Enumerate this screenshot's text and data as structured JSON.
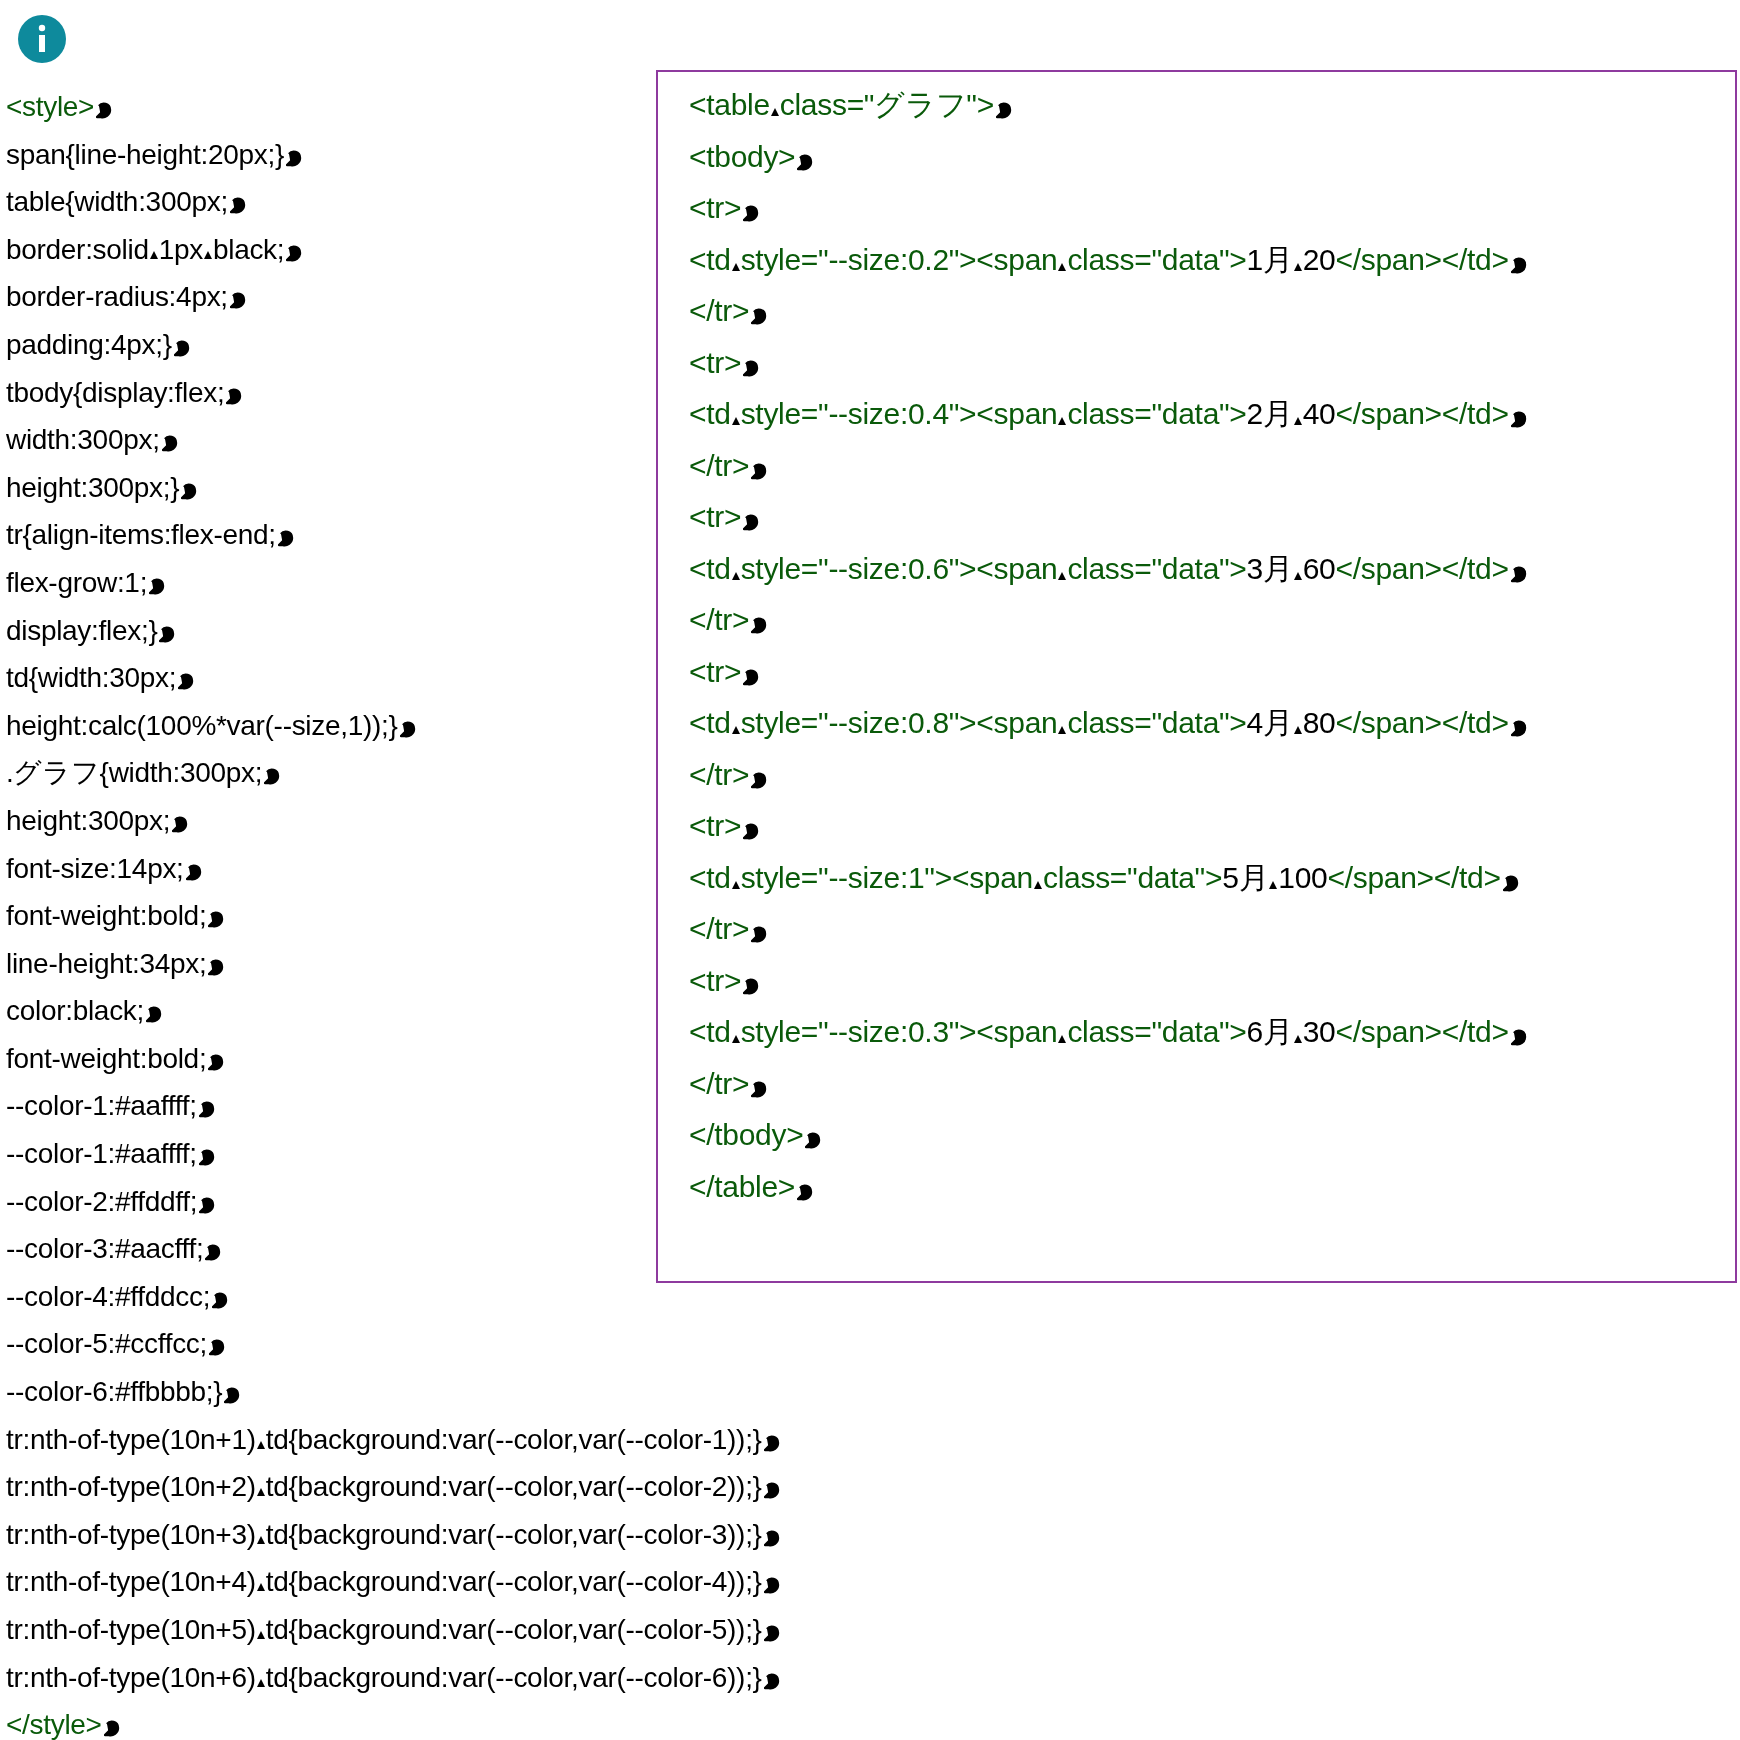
{
  "style_block": {
    "lines": [
      [
        {
          "kind": "tag",
          "text": "<style>"
        }
      ],
      [
        {
          "kind": "code",
          "text": "span{line-height:20px;}"
        }
      ],
      [
        {
          "kind": "code",
          "text": "table{width:300px;"
        }
      ],
      [
        {
          "kind": "code",
          "text": "border:solid 1px black;"
        }
      ],
      [
        {
          "kind": "code",
          "text": "border-radius:4px;"
        }
      ],
      [
        {
          "kind": "code",
          "text": "padding:4px;}"
        }
      ],
      [
        {
          "kind": "code",
          "text": "tbody{display:flex;"
        }
      ],
      [
        {
          "kind": "code",
          "text": "width:300px;"
        }
      ],
      [
        {
          "kind": "code",
          "text": "height:300px;}"
        }
      ],
      [
        {
          "kind": "code",
          "text": "tr{align-items:flex-end;"
        }
      ],
      [
        {
          "kind": "code",
          "text": "flex-grow:1;"
        }
      ],
      [
        {
          "kind": "code",
          "text": "display:flex;}"
        }
      ],
      [
        {
          "kind": "code",
          "text": "td{width:30px;"
        }
      ],
      [
        {
          "kind": "code",
          "text": "height:calc(100%*var(--size,1));}"
        }
      ],
      [
        {
          "kind": "code",
          "text": ".グラフ{width:300px;"
        }
      ],
      [
        {
          "kind": "code",
          "text": "height:300px;"
        }
      ],
      [
        {
          "kind": "code",
          "text": "font-size:14px;"
        }
      ],
      [
        {
          "kind": "code",
          "text": "font-weight:bold;"
        }
      ],
      [
        {
          "kind": "code",
          "text": "line-height:34px;"
        }
      ],
      [
        {
          "kind": "code",
          "text": "color:black;"
        }
      ],
      [
        {
          "kind": "code",
          "text": "font-weight:bold;"
        }
      ],
      [
        {
          "kind": "code",
          "text": "--color-1:#aaffff;"
        }
      ],
      [
        {
          "kind": "code",
          "text": "--color-1:#aaffff;"
        }
      ],
      [
        {
          "kind": "code",
          "text": "--color-2:#ffddff;"
        }
      ],
      [
        {
          "kind": "code",
          "text": "--color-3:#aacfff;"
        }
      ],
      [
        {
          "kind": "code",
          "text": "--color-4:#ffddcc;"
        }
      ],
      [
        {
          "kind": "code",
          "text": "--color-5:#ccffcc;"
        }
      ],
      [
        {
          "kind": "code",
          "text": "--color-6:#ffbbbb;}"
        }
      ],
      [
        {
          "kind": "code",
          "text": "tr:nth-of-type(10n+1) td{background:var(--color,var(--color-1));}"
        }
      ],
      [
        {
          "kind": "code",
          "text": "tr:nth-of-type(10n+2) td{background:var(--color,var(--color-2));}"
        }
      ],
      [
        {
          "kind": "code",
          "text": "tr:nth-of-type(10n+3) td{background:var(--color,var(--color-3));}"
        }
      ],
      [
        {
          "kind": "code",
          "text": "tr:nth-of-type(10n+4) td{background:var(--color,var(--color-4));}"
        }
      ],
      [
        {
          "kind": "code",
          "text": "tr:nth-of-type(10n+5) td{background:var(--color,var(--color-5));}"
        }
      ],
      [
        {
          "kind": "code",
          "text": "tr:nth-of-type(10n+6) td{background:var(--color,var(--color-6));}"
        }
      ],
      [
        {
          "kind": "tag",
          "text": "</style>"
        }
      ]
    ]
  },
  "table_block": {
    "lines": [
      [
        {
          "kind": "tag",
          "text": "<table class=\"グラフ\">"
        }
      ],
      [
        {
          "kind": "tag",
          "text": "<tbody>"
        }
      ],
      [
        {
          "kind": "tag",
          "text": "<tr>"
        }
      ],
      [
        {
          "kind": "tag",
          "text": "<td style=\"--size:0.2\"><span class=\"data\">"
        },
        {
          "kind": "code",
          "text": "1月 20"
        },
        {
          "kind": "tag",
          "text": "</span></td>"
        }
      ],
      [
        {
          "kind": "tag",
          "text": "</tr>"
        }
      ],
      [
        {
          "kind": "tag",
          "text": "<tr>"
        }
      ],
      [
        {
          "kind": "tag",
          "text": "<td style=\"--size:0.4\"><span class=\"data\">"
        },
        {
          "kind": "code",
          "text": "2月 40"
        },
        {
          "kind": "tag",
          "text": "</span></td>"
        }
      ],
      [
        {
          "kind": "tag",
          "text": "</tr>"
        }
      ],
      [
        {
          "kind": "tag",
          "text": "<tr>"
        }
      ],
      [
        {
          "kind": "tag",
          "text": "<td style=\"--size:0.6\"><span class=\"data\">"
        },
        {
          "kind": "code",
          "text": "3月 60"
        },
        {
          "kind": "tag",
          "text": "</span></td>"
        }
      ],
      [
        {
          "kind": "tag",
          "text": "</tr>"
        }
      ],
      [
        {
          "kind": "tag",
          "text": "<tr>"
        }
      ],
      [
        {
          "kind": "tag",
          "text": "<td style=\"--size:0.8\"><span class=\"data\">"
        },
        {
          "kind": "code",
          "text": "4月 80"
        },
        {
          "kind": "tag",
          "text": "</span></td>"
        }
      ],
      [
        {
          "kind": "tag",
          "text": "</tr>"
        }
      ],
      [
        {
          "kind": "tag",
          "text": "<tr>"
        }
      ],
      [
        {
          "kind": "tag",
          "text": "<td style=\"--size:1\"><span class=\"data\">"
        },
        {
          "kind": "code",
          "text": "5月 100"
        },
        {
          "kind": "tag",
          "text": "</span></td>"
        }
      ],
      [
        {
          "kind": "tag",
          "text": "</tr>"
        }
      ],
      [
        {
          "kind": "tag",
          "text": "<tr>"
        }
      ],
      [
        {
          "kind": "tag",
          "text": "<td style=\"--size:0.3\"><span class=\"data\">"
        },
        {
          "kind": "code",
          "text": "6月 30"
        },
        {
          "kind": "tag",
          "text": "</span></td>"
        }
      ],
      [
        {
          "kind": "tag",
          "text": "</tr>"
        }
      ],
      [
        {
          "kind": "tag",
          "text": "</tbody>"
        }
      ],
      [
        {
          "kind": "tag",
          "text": "</table>"
        }
      ]
    ]
  }
}
